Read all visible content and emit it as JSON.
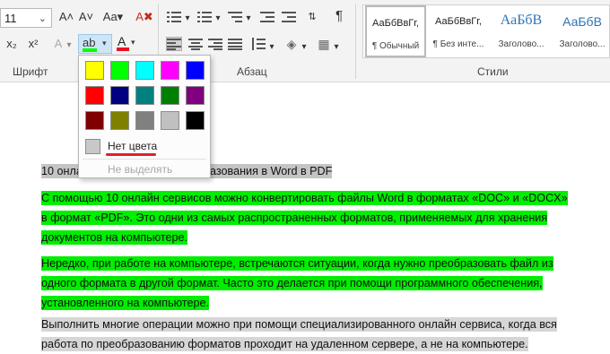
{
  "ribbon": {
    "font_size": "11",
    "groups": {
      "font": "Шрифт",
      "paragraph": "Абзац",
      "styles": "Стили"
    },
    "buttons": {
      "grow_font": "A˄",
      "shrink_font": "A˅",
      "change_case": "Aa▾",
      "clear_format": "A✖",
      "subscript": "x₂",
      "superscript": "x²",
      "text_effects": "A",
      "highlight": "ab",
      "font_color": "A"
    },
    "highlight_color": "#00ff00",
    "font_color_value": "#e81123",
    "pilcrow": "¶",
    "styles": [
      {
        "sample": "АаБбВвГг,",
        "name": "¶ Обычный"
      },
      {
        "sample": "АаБбВвГг,",
        "name": "¶ Без инте..."
      },
      {
        "sample": "АаБбВ",
        "name": "Заголово..."
      },
      {
        "sample": "АаБбВ",
        "name": "Заголово..."
      }
    ]
  },
  "highlight_menu": {
    "colors": [
      "#ffff00",
      "#00ff00",
      "#00ffff",
      "#ff00ff",
      "#0000ff",
      "#ff0000",
      "#000080",
      "#008080",
      "#008000",
      "#800080",
      "#800000",
      "#808000",
      "#808080",
      "#c0c0c0",
      "#000000"
    ],
    "no_color": "Нет цвета",
    "stop": "Не выделять"
  },
  "document": {
    "lines": [
      {
        "text": "10 онлайн сервисов для преобразования в Word в PDF",
        "hl": "gray"
      },
      {
        "text": "С помощью 10 онлайн сервисов можно конвертировать файлы Word в форматах «DOC» и «DOCX»",
        "hl": "green"
      },
      {
        "text": "в формат «PDF». Это одни из самых распространенных форматов, применяемых для хранения",
        "hl": "green"
      },
      {
        "text": "документов на компьютере.",
        "hl": "green"
      },
      {
        "text": "Нередко, при работе на компьютере, встречаются ситуации, когда нужно преобразовать файл из",
        "hl": "green"
      },
      {
        "text": "одного формата в другой формат. Часто это делается при помощи программного обеспечения,",
        "hl": "green"
      },
      {
        "text": "установленного на компьютере.",
        "hl": "green"
      },
      {
        "text": "Выполнить многие операции можно при помощи специализированного онлайн сервиса, когда вся",
        "hl": "lgray"
      },
      {
        "text": "работа по преобразованию форматов проходит на удаленном сервере, а не на компьютере.",
        "hl": "lgray"
      }
    ]
  }
}
